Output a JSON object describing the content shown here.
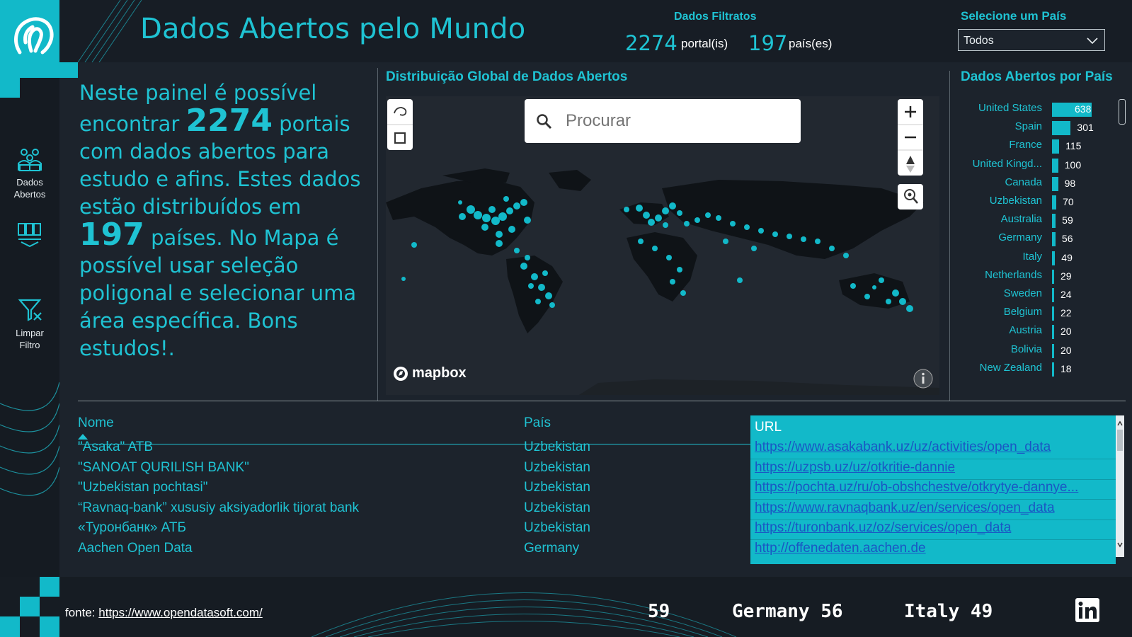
{
  "header": {
    "title": "Dados Abertos pelo Mundo",
    "kpi_label": "Dados Filtratos",
    "portals_count": "2274",
    "portals_unit": "portal(is)",
    "countries_count": "197",
    "countries_unit": "país(es)",
    "select_label": "Selecione um País",
    "select_value": "Todos"
  },
  "rail": {
    "item1_line1": "Dados",
    "item1_line2": "Abertos",
    "item3_line1": "Limpar",
    "item3_line2": "Filtro"
  },
  "intro": {
    "p1": "Neste painel é possível encontrar ",
    "num1": "2274",
    "p2": " portais com dados abertos para estudo e afins. Estes dados estão distribuídos em ",
    "num2": "197",
    "p3": " países. No Mapa é possível usar seleção poligonal e selecionar uma área específica. Bons estudos!."
  },
  "map": {
    "title": "Distribuição Global de Dados Abertos",
    "search_placeholder": "Procurar",
    "attribution": "mapbox",
    "icons": [
      "lasso-icon",
      "rectangle-select-icon",
      "zoom-in-icon",
      "zoom-out-icon",
      "compass-icon",
      "locate-icon",
      "info-icon",
      "search-icon"
    ]
  },
  "bars": {
    "title": "Dados Abertos por País",
    "max": 638,
    "items": [
      {
        "name": "United States",
        "value": 638
      },
      {
        "name": "Spain",
        "value": 301
      },
      {
        "name": "France",
        "value": 115
      },
      {
        "name": "United Kingd...",
        "value": 100
      },
      {
        "name": "Canada",
        "value": 98
      },
      {
        "name": "Uzbekistan",
        "value": 70
      },
      {
        "name": "Australia",
        "value": 59
      },
      {
        "name": "Germany",
        "value": 56
      },
      {
        "name": "Italy",
        "value": 49
      },
      {
        "name": "Netherlands",
        "value": 29
      },
      {
        "name": "Sweden",
        "value": 24
      },
      {
        "name": "Belgium",
        "value": 22
      },
      {
        "name": "Austria",
        "value": 20
      },
      {
        "name": "Bolivia",
        "value": 20
      },
      {
        "name": "New Zealand",
        "value": 18
      }
    ]
  },
  "table": {
    "headers": {
      "name": "Nome",
      "country": "País",
      "url": "URL"
    },
    "rows": [
      {
        "name": "\"Asaka\" ATB",
        "country": "Uzbekistan",
        "url": "https://www.asakabank.uz/uz/activities/open_data"
      },
      {
        "name": "\"SANOAT QURILISH BANK\"",
        "country": "Uzbekistan",
        "url": "https://uzpsb.uz/uz/otkritie-dannie"
      },
      {
        "name": "\"Uzbekistan pochtasi\"",
        "country": "Uzbekistan",
        "url": "https://pochta.uz/ru/ob-obshchestve/otkrytye-dannye..."
      },
      {
        "name": "“Ravnaq-bank” xususiy aksiyadorlik tijorat bank",
        "country": "Uzbekistan",
        "url": "https://www.ravnaqbank.uz/en/services/open_data"
      },
      {
        "name": "«Туронбанк» АТБ",
        "country": "Uzbekistan",
        "url": "https://turonbank.uz/oz/services/open_data"
      },
      {
        "name": "Aachen Open Data",
        "country": "Germany",
        "url": "http://offenedaten.aachen.de"
      }
    ]
  },
  "footer": {
    "source_label": "fonte: ",
    "source_link": "https://www.opendatasoft.com/",
    "ticker": [
      "59",
      "Germany 56",
      "Italy 49"
    ]
  },
  "colors": {
    "accent": "#12b9c9",
    "background": "#1c232c",
    "text": "#1fc3d3"
  }
}
